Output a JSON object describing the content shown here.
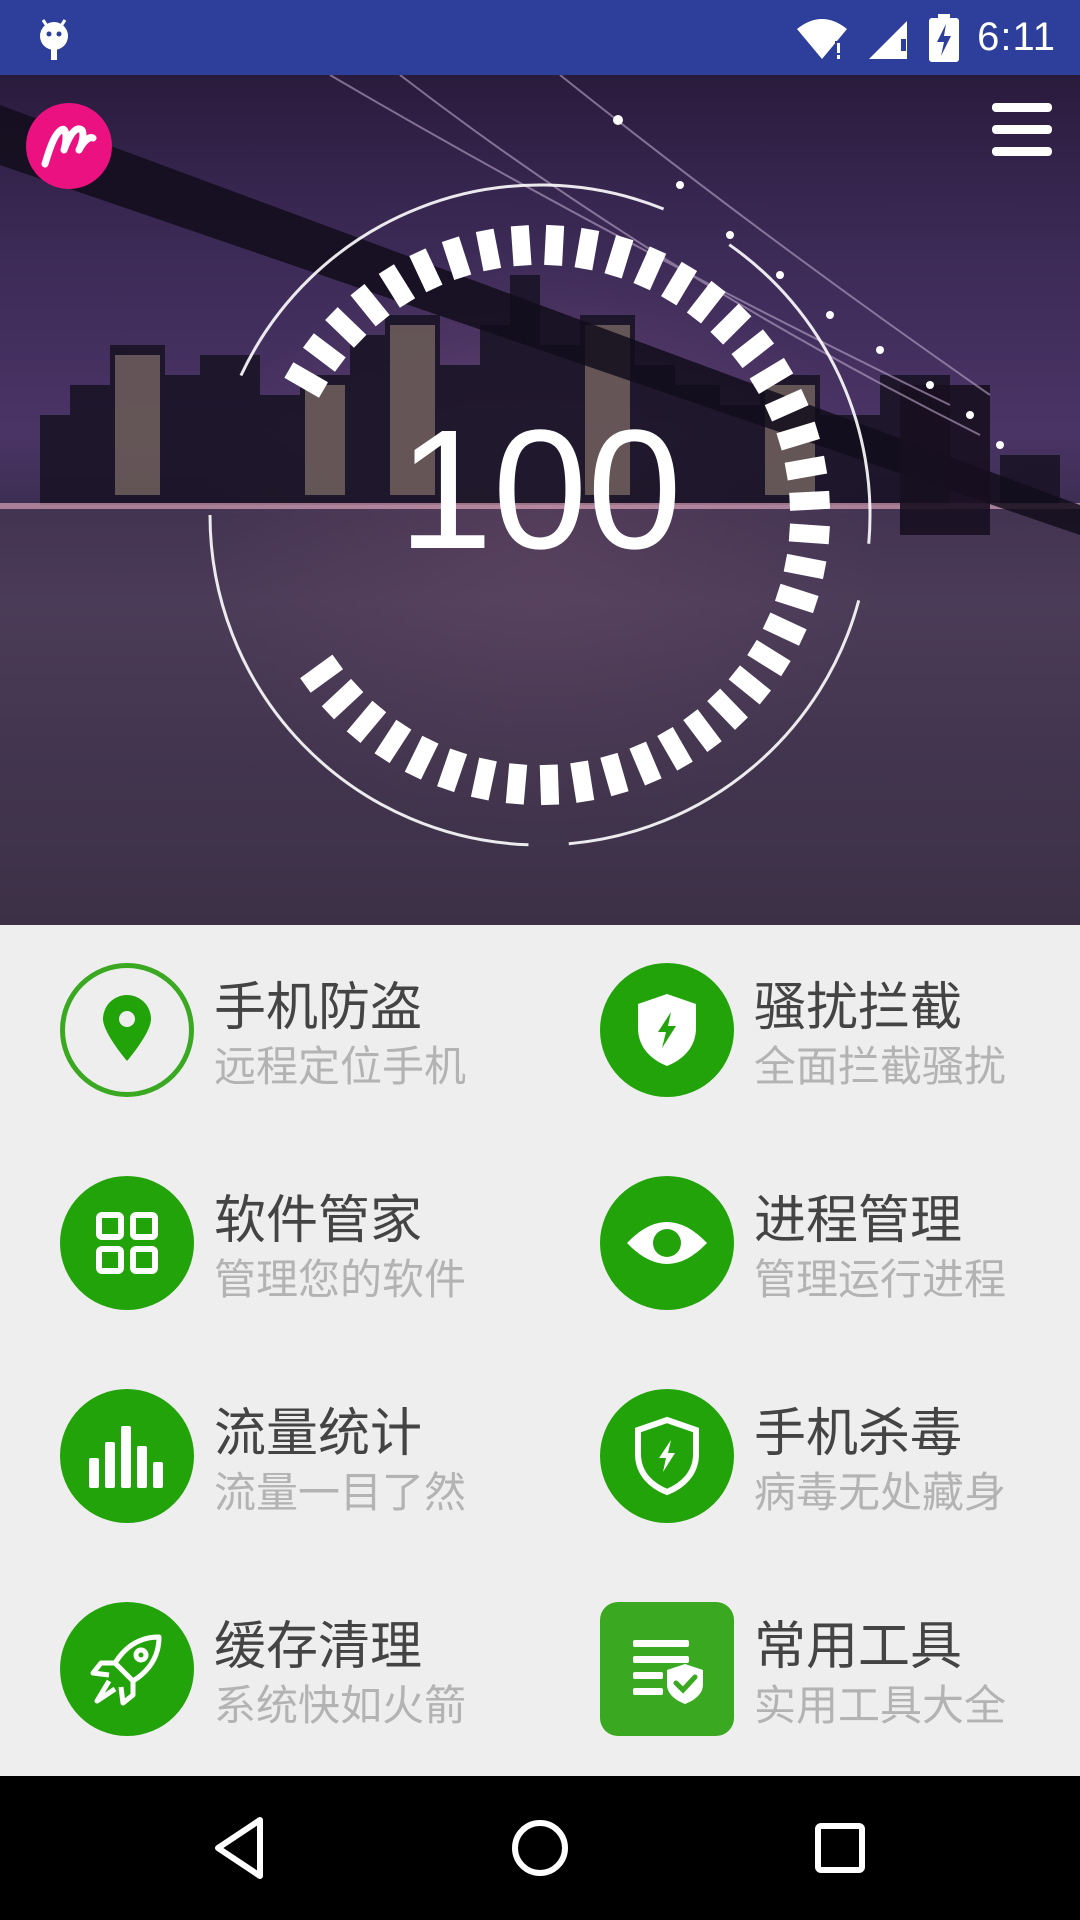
{
  "status_bar": {
    "time": "6:11",
    "icons": [
      "android-debug-icon",
      "wifi-icon",
      "signal-icon",
      "battery-charging-icon"
    ]
  },
  "header": {
    "logo_icon": "logo-m-icon",
    "menu_icon": "menu-icon"
  },
  "hero": {
    "score": "100"
  },
  "features": [
    {
      "title": "手机防盗",
      "subtitle": "远程定位手机",
      "icon": "location-pin-icon"
    },
    {
      "title": "骚扰拦截",
      "subtitle": "全面拦截骚扰",
      "icon": "shield-bolt-icon"
    },
    {
      "title": "软件管家",
      "subtitle": "管理您的软件",
      "icon": "apps-grid-icon"
    },
    {
      "title": "进程管理",
      "subtitle": "管理运行进程",
      "icon": "eye-icon"
    },
    {
      "title": "流量统计",
      "subtitle": "流量一目了然",
      "icon": "bar-chart-icon"
    },
    {
      "title": "手机杀毒",
      "subtitle": "病毒无处藏身",
      "icon": "shield-outline-icon"
    },
    {
      "title": "缓存清理",
      "subtitle": "系统快如火箭",
      "icon": "rocket-icon"
    },
    {
      "title": "常用工具",
      "subtitle": "实用工具大全",
      "icon": "document-check-icon"
    }
  ],
  "nav_bar": {
    "buttons": [
      "back-icon",
      "home-icon",
      "recents-icon"
    ]
  },
  "colors": {
    "status_bar": "#2e3f9b",
    "accent_green": "#22a30a",
    "logo_pink": "#ec1181"
  }
}
